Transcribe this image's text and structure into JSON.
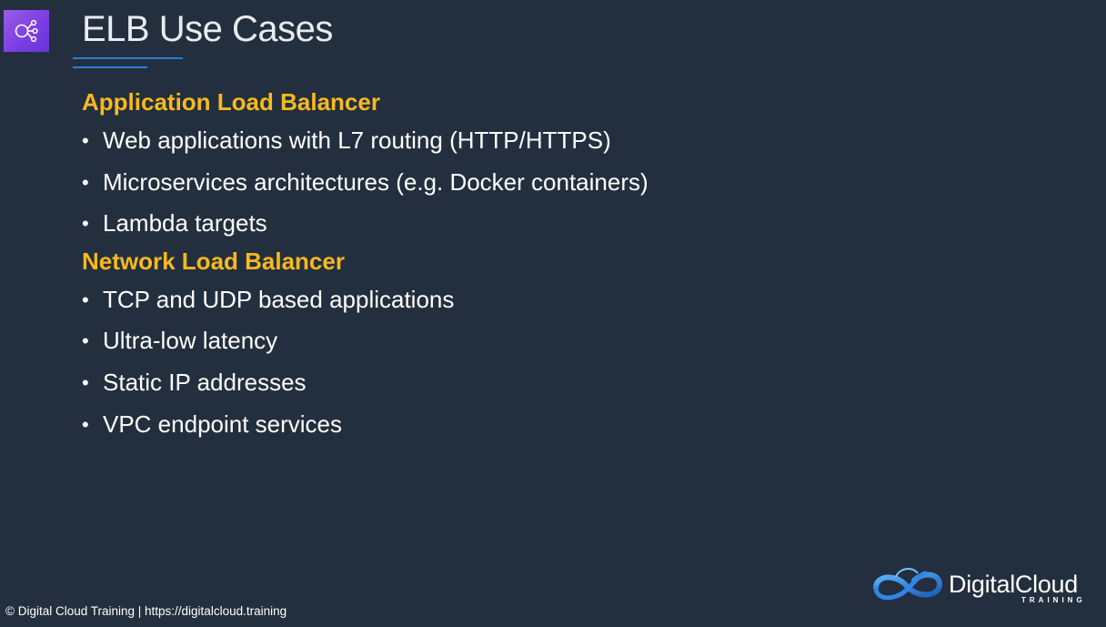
{
  "slide": {
    "title": "ELB Use Cases",
    "sections": [
      {
        "heading": "Application Load Balancer",
        "bullets": [
          "Web applications with L7 routing (HTTP/HTTPS)",
          "Microservices architectures (e.g. Docker containers)",
          "Lambda targets"
        ]
      },
      {
        "heading": "Network Load Balancer",
        "bullets": [
          "TCP and UDP based applications",
          "Ultra-low latency",
          "Static IP addresses",
          "VPC endpoint services"
        ]
      }
    ],
    "bullet_glyph": "•"
  },
  "footer": {
    "copyright": "© Digital Cloud Training  |  https://digitalcloud.training"
  },
  "logo": {
    "name": "DigitalCloud",
    "sub": "TRAINING",
    "icon": "infinity-cloud-logo-icon"
  },
  "icons": {
    "service_icon": "elastic-load-balancing-icon"
  },
  "colors": {
    "background": "#232f3e",
    "heading": "#f7b91e",
    "text": "#ffffff",
    "accent_rule": "#2a7fd4",
    "icon_bg": "#7b3fe4"
  }
}
